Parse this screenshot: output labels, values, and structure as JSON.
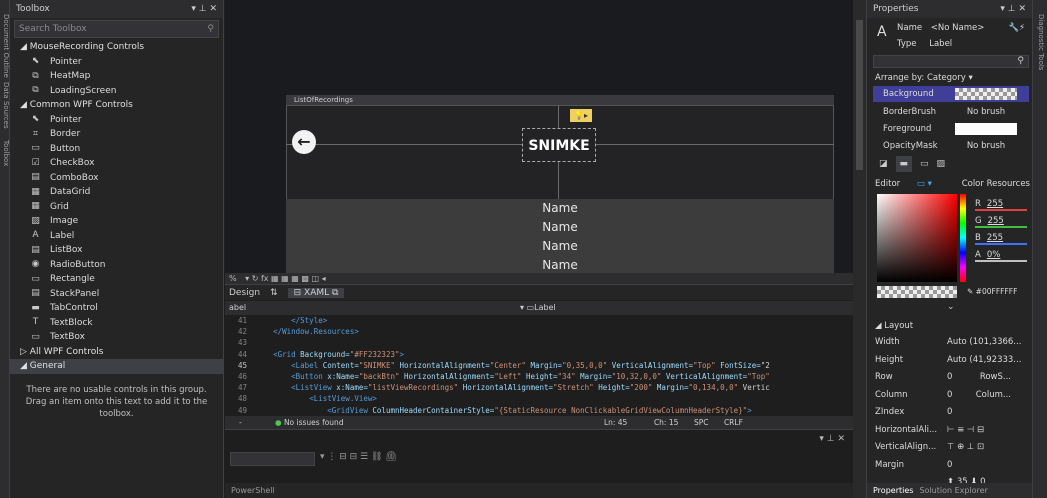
{
  "left_strip": {
    "tabs": [
      "Document Outline",
      "Data Sources",
      "Toolbox"
    ]
  },
  "toolbox": {
    "title": "Toolbox",
    "search_placeholder": "Search Toolbox",
    "groups": [
      {
        "label": "◢ MouseRecording Controls",
        "items": [
          {
            "icon": "pointer-icon",
            "glyph": "⬉",
            "label": "Pointer"
          },
          {
            "icon": "usercontrol-icon",
            "glyph": "⧉",
            "label": "HeatMap"
          },
          {
            "icon": "usercontrol-icon",
            "glyph": "⧉",
            "label": "LoadingScreen"
          }
        ]
      },
      {
        "label": "◢ Common WPF Controls",
        "items": [
          {
            "icon": "pointer-icon",
            "glyph": "⬉",
            "label": "Pointer"
          },
          {
            "icon": "border-icon",
            "glyph": "⌗",
            "label": "Border"
          },
          {
            "icon": "button-icon",
            "glyph": "▭",
            "label": "Button"
          },
          {
            "icon": "checkbox-icon",
            "glyph": "☑",
            "label": "CheckBox"
          },
          {
            "icon": "combobox-icon",
            "glyph": "▤",
            "label": "ComboBox"
          },
          {
            "icon": "datagrid-icon",
            "glyph": "▦",
            "label": "DataGrid"
          },
          {
            "icon": "grid-icon",
            "glyph": "▦",
            "label": "Grid"
          },
          {
            "icon": "image-icon",
            "glyph": "▨",
            "label": "Image"
          },
          {
            "icon": "label-icon",
            "glyph": "A",
            "label": "Label"
          },
          {
            "icon": "listbox-icon",
            "glyph": "▤",
            "label": "ListBox"
          },
          {
            "icon": "radiobutton-icon",
            "glyph": "◉",
            "label": "RadioButton"
          },
          {
            "icon": "rectangle-icon",
            "glyph": "▭",
            "label": "Rectangle"
          },
          {
            "icon": "stackpanel-icon",
            "glyph": "▤",
            "label": "StackPanel"
          },
          {
            "icon": "tabcontrol-icon",
            "glyph": "▬",
            "label": "TabControl"
          },
          {
            "icon": "textblock-icon",
            "glyph": "T",
            "label": "TextBlock"
          },
          {
            "icon": "textbox-icon",
            "glyph": "▭",
            "label": "TextBox"
          }
        ]
      }
    ],
    "all_wpf": "▷ All WPF Controls",
    "general": "◢ General",
    "empty_message": "There are no usable controls in this group. Drag an item onto this text to add it to the toolbox."
  },
  "designer": {
    "window_title": "ListOfRecordings",
    "label_content": "SNIMKE",
    "back_glyph": "←",
    "list_rows": [
      "Name",
      "Name",
      "Name",
      "Name"
    ],
    "zoom": "%"
  },
  "tabs": {
    "design": "Design",
    "swap": "⇅",
    "xaml": "XAML"
  },
  "element_bar": {
    "left": "abel",
    "right": "Label"
  },
  "code": [
    {
      "n": "41",
      "text": "        </Style>"
    },
    {
      "n": "42",
      "text": "    </Window.Resources>"
    },
    {
      "n": "43",
      "text": ""
    },
    {
      "n": "44",
      "text": "    <Grid Background=\"#FF232323\">"
    },
    {
      "n": "45",
      "text": "        <Label Content=\"SNIMKE\" HorizontalAlignment=\"Center\" Margin=\"0,35,0,0\" VerticalAlignment=\"Top\" FontSize=\"2"
    },
    {
      "n": "46",
      "text": "        <Button x:Name=\"backBtn\" HorizontalAlignment=\"Left\" Height=\"34\" Margin=\"10,32,0,0\" VerticalAlignment=\"Top\""
    },
    {
      "n": "47",
      "text": "        <ListView x:Name=\"listViewRecordings\" HorizontalAlignment=\"Stretch\" Height=\"200\" Margin=\"0,134,0,0\" Vertic"
    },
    {
      "n": "48",
      "text": "            <ListView.View>"
    },
    {
      "n": "49",
      "text": "                <GridView ColumnHeaderContainerStyle=\"{StaticResource NonClickableGridViewColumnHeaderStyle}\">"
    }
  ],
  "status": {
    "zoom": "- ",
    "issues": "No issues found",
    "ln": "Ln: 45",
    "ch": "Ch: 15",
    "spc": "SPC",
    "crlf": "CRLF"
  },
  "bottom_tab": "PowerShell",
  "properties": {
    "title": "Properties",
    "name_label": "Name",
    "name_value": "<No Name>",
    "type_label": "Type",
    "type_value": "Label",
    "arrange": "Arrange by: Category ▾",
    "brushes": [
      {
        "name": "Background",
        "value": ""
      },
      {
        "name": "BorderBrush",
        "value": "No brush"
      },
      {
        "name": "Foreground",
        "value": ""
      },
      {
        "name": "OpacityMask",
        "value": "No brush"
      }
    ],
    "editor_label": "Editor",
    "color_resources": "Color Resources",
    "rgba": [
      {
        "ch": "R",
        "v": "255"
      },
      {
        "ch": "G",
        "v": "255"
      },
      {
        "ch": "B",
        "v": "255"
      },
      {
        "ch": "A",
        "v": "0%"
      }
    ],
    "hex": "#00FFFFFF",
    "layout_header": "◢ Layout",
    "layout": [
      {
        "name": "Width",
        "value": "Auto (101,3366..."
      },
      {
        "name": "Height",
        "value": "Auto (41,92333..."
      },
      {
        "name": "Row",
        "value": "0"
      },
      {
        "name": "Column",
        "value": "0"
      },
      {
        "name": "ZIndex",
        "value": "0"
      },
      {
        "name": "HorizontalAli...",
        "value": ""
      },
      {
        "name": "VerticalAlign...",
        "value": ""
      },
      {
        "name": "Margin",
        "value": "0"
      }
    ],
    "row_span": "RowS...",
    "col_span": "Colum...",
    "margin_values": [
      "0",
      "0",
      "35",
      "0"
    ],
    "bottom_tabs": [
      "Properties",
      "Solution Explorer"
    ]
  },
  "right_strip": "Diagnostic Tools",
  "colors": {
    "selected_row": "#3f3f99",
    "accent": "#007acc"
  }
}
